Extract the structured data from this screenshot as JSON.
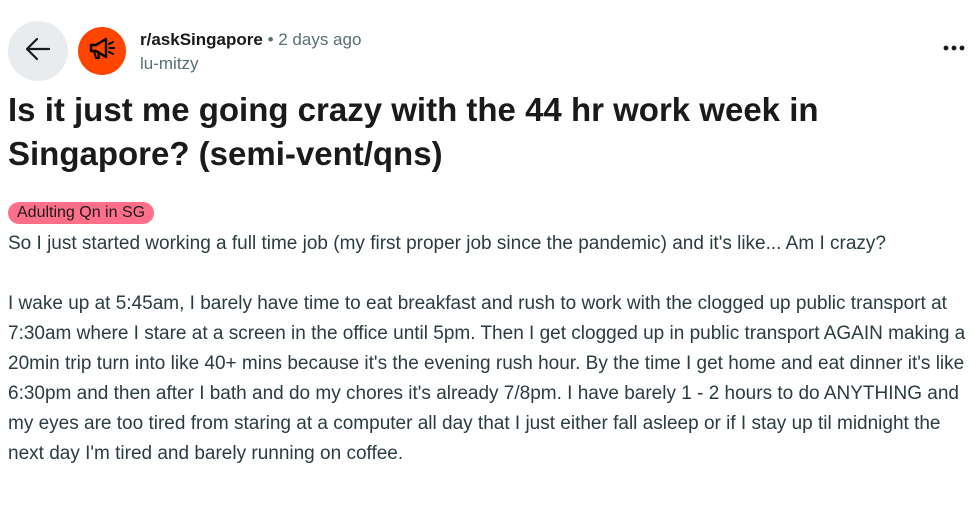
{
  "header": {
    "subreddit": "r/askSingapore",
    "separator": "•",
    "time_ago": "2 days ago",
    "author": "lu-mitzy"
  },
  "icons": {
    "back": "arrow-left-icon",
    "community": "megaphone-icon",
    "more": "more-dots-icon"
  },
  "post": {
    "title": "Is it just me going crazy with the 44 hr work week in Singapore? (semi-vent/qns)",
    "flair": "Adulting Qn in SG",
    "paragraphs": [
      "So I just started working a full time job (my first proper job since the pandemic) and it's like... Am I crazy?",
      "I wake up at 5:45am, I barely have time to eat breakfast and rush to work with the clogged up public transport at 7:30am where I stare at a screen in the office until 5pm. Then I get clogged up in public transport AGAIN making a 20min trip turn into like 40+ mins because it's the evening rush hour. By the time I get home and eat dinner it's like 6:30pm and then after I bath and do my chores it's already 7/8pm. I have barely 1 - 2 hours to do ANYTHING and my eyes are too tired from staring at a computer all day that I just either fall asleep or if I stay up til midnight the next day I'm tired and barely running on coffee."
    ]
  },
  "colors": {
    "community_icon_bg": "#ff4500",
    "flair_bg": "#ff6f8a",
    "back_button_bg": "#e9ecee",
    "muted_text": "#576f76"
  }
}
